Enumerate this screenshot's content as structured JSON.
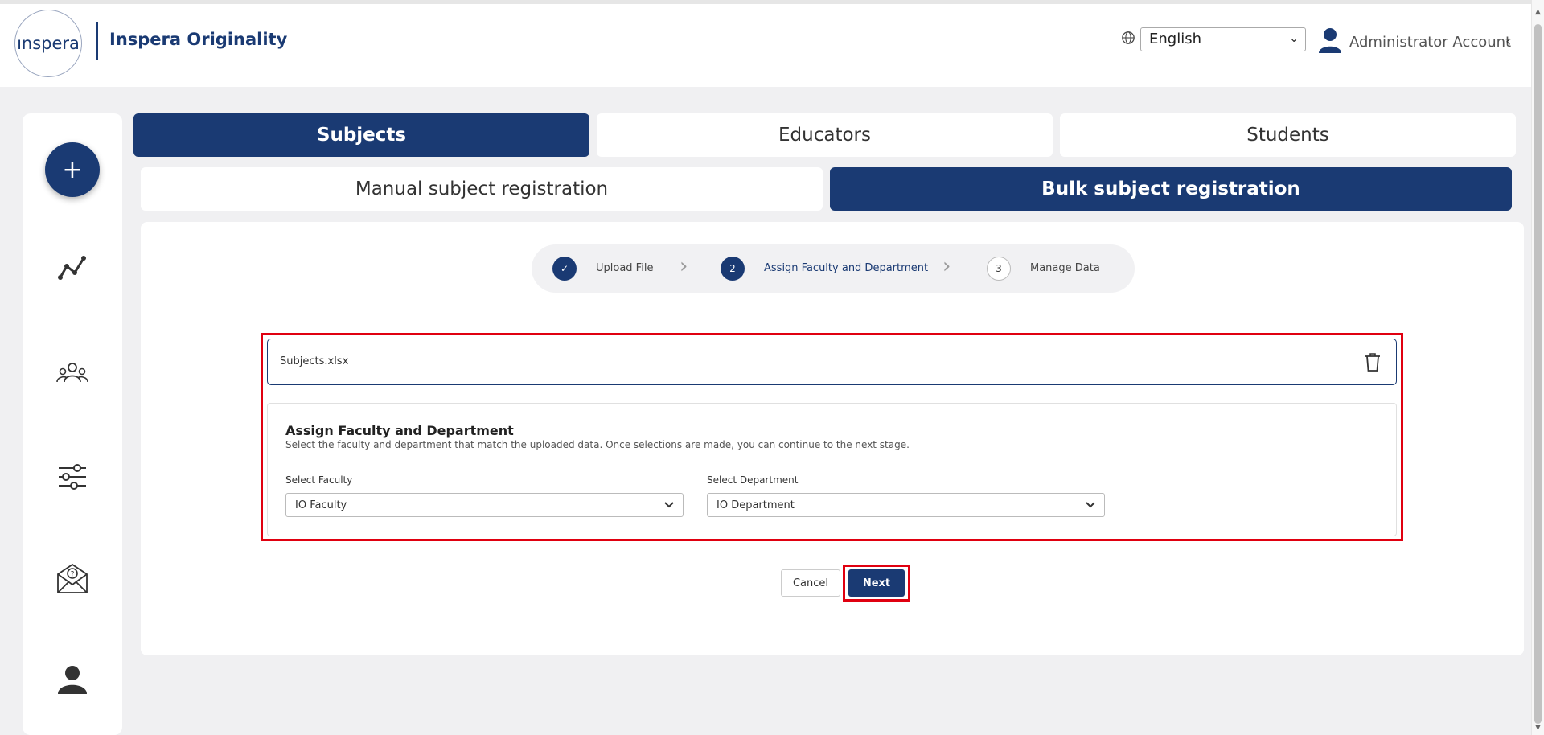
{
  "header": {
    "logo_text": "ınspera",
    "brand": "Inspera Originality",
    "language": "English",
    "user_name": "Administrator Account",
    "globe_icon": "globe-icon",
    "user_icon": "user-icon"
  },
  "sidebar": {
    "add_label": "+",
    "items": [
      {
        "icon": "analytics-icon"
      },
      {
        "icon": "users-icon"
      },
      {
        "icon": "settings-sliders-icon"
      },
      {
        "icon": "help-mail-icon"
      },
      {
        "icon": "profile-icon"
      }
    ]
  },
  "tabs": {
    "main": [
      {
        "label": "Subjects",
        "active": true
      },
      {
        "label": "Educators",
        "active": false
      },
      {
        "label": "Students",
        "active": false
      }
    ],
    "sub": [
      {
        "label": "Manual subject registration",
        "active": false
      },
      {
        "label": "Bulk subject registration",
        "active": true
      }
    ]
  },
  "stepper": {
    "steps": [
      {
        "marker": "✓",
        "label": "Upload File",
        "state": "done"
      },
      {
        "marker": "2",
        "label": "Assign Faculty and Department",
        "state": "current"
      },
      {
        "marker": "3",
        "label": "Manage Data",
        "state": "pending"
      }
    ]
  },
  "file": {
    "name": "Subjects.xlsx"
  },
  "assign": {
    "title": "Assign Faculty and Department",
    "description": "Select the faculty and department that match the uploaded data. Once selections are made, you can continue to the next stage.",
    "faculty_label": "Select Faculty",
    "faculty_value": "IO Faculty",
    "department_label": "Select Department",
    "department_value": "IO Department"
  },
  "actions": {
    "cancel_label": "Cancel",
    "next_label": "Next"
  },
  "colors": {
    "primary": "#1a3a73",
    "highlight": "#e00010"
  }
}
